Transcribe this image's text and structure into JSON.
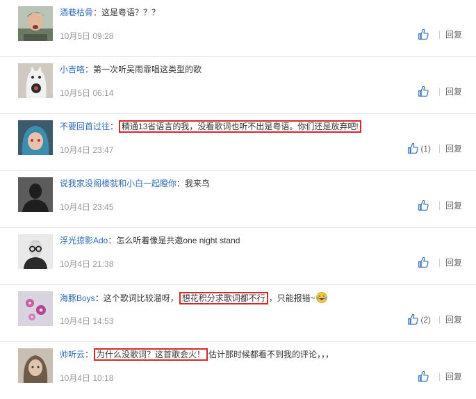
{
  "comments": [
    {
      "user": "酒巷枯骨",
      "sep": "：",
      "text": "这是粤语？？？",
      "highlight": "",
      "after": "",
      "emoji": false,
      "time": "10月5日 09:28",
      "likes": "",
      "reply": "回复",
      "avatar_icon": "avatar-young-man"
    },
    {
      "user": "小吉咯",
      "sep": "：",
      "text": "第一次听吴雨霏唱这类型的歌",
      "highlight": "",
      "after": "",
      "emoji": false,
      "time": "10月5日 06:14",
      "likes": "",
      "reply": "回复",
      "avatar_icon": "avatar-cat"
    },
    {
      "user": "不要回首过往",
      "sep": "：",
      "text": "",
      "highlight": "精通13省语言的我，没看歌词也听不出是粤语。你们还是放弃吧!",
      "after": "",
      "emoji": false,
      "time": "10月4日 23:47",
      "likes": "(1)",
      "reply": "回复",
      "avatar_icon": "avatar-anime-girl"
    },
    {
      "user": "说我家没阁楼就和小白一起瞪你",
      "sep": "：",
      "text": "我来鸟",
      "highlight": "",
      "after": "",
      "emoji": false,
      "time": "10月4日 23:45",
      "likes": "",
      "reply": "回复",
      "avatar_icon": "avatar-silhouette"
    },
    {
      "user": "浮光掠影Ado",
      "sep": "：",
      "text": "怎么听着像是共邀one night stand",
      "highlight": "",
      "after": "",
      "emoji": false,
      "time": "10月4日 21:38",
      "likes": "",
      "reply": "回复",
      "avatar_icon": "avatar-glasses-man"
    },
    {
      "user": "海豚Boys",
      "sep": "：",
      "text": "这个歌词比较溜呀，",
      "highlight": "想花积分求歌词都不行",
      "after": "，只能报错~",
      "emoji": true,
      "time": "10月4日 14:53",
      "likes": "(2)",
      "reply": "回复",
      "avatar_icon": "avatar-pink-flowers"
    },
    {
      "user": "帅听云",
      "sep": "：",
      "text": "",
      "highlight": "为什么没歌词？这首歌会火！",
      "after": "估计那时候都看不到我的评论，，，",
      "emoji": false,
      "time": "10月4日 10:18",
      "likes": "",
      "reply": "回复",
      "avatar_icon": "avatar-child"
    }
  ],
  "colors": {
    "username": "#2f6eb5",
    "highlight_border": "#d62828",
    "like_icon": "#2f6eb5",
    "time": "#999999"
  }
}
